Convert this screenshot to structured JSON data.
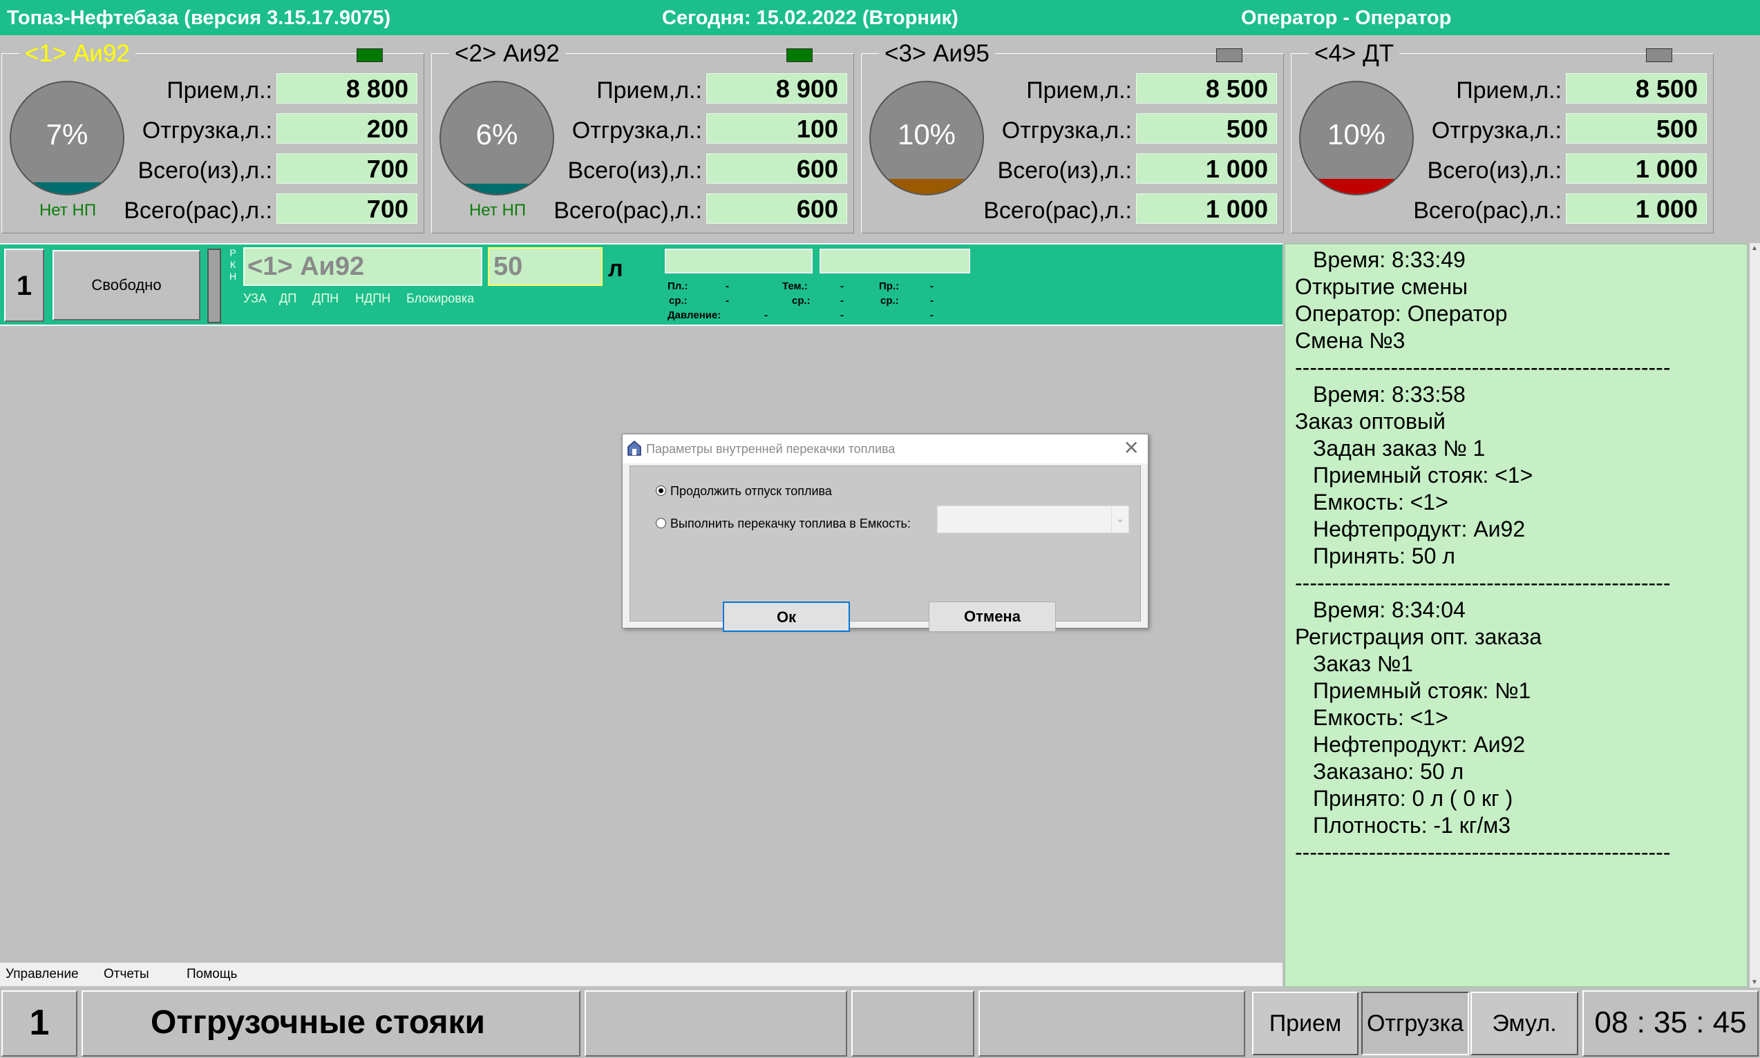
{
  "header": {
    "app_title": "Топаз-Нефтебаза  (версия 3.15.17.9075)",
    "date": "Сегодня: 15.02.2022  (Вторник)",
    "user": "Оператор - Оператор"
  },
  "labels": {
    "receive": "Прием,л.:",
    "ship": "Отгрузка,л.:",
    "total_in": "Всего(из),л.:",
    "total_out": "Всего(рас),л.:"
  },
  "tanks": [
    {
      "title": "<1> Аи92",
      "active": true,
      "led_color": "#007a00",
      "percent": "7%",
      "level": 0.07,
      "fill_color": "#006e6e",
      "status": "Нет НП",
      "receive": "8 800",
      "ship": "200",
      "total_in": "700",
      "total_out": "700"
    },
    {
      "title": "<2> Аи92",
      "active": false,
      "led_color": "#007a00",
      "percent": "6%",
      "level": 0.06,
      "fill_color": "#006e6e",
      "status": "Нет НП",
      "receive": "8 900",
      "ship": "100",
      "total_in": "600",
      "total_out": "600"
    },
    {
      "title": "<3> Аи95",
      "active": false,
      "led_color": "#8a8a8a",
      "percent": "10%",
      "level": 0.1,
      "fill_color": "#9a5a00",
      "status": "",
      "receive": "8 500",
      "ship": "500",
      "total_in": "1 000",
      "total_out": "1 000"
    },
    {
      "title": "<4> ДТ",
      "active": false,
      "led_color": "#8a8a8a",
      "percent": "10%",
      "level": 0.1,
      "fill_color": "#c00000",
      "status": "",
      "receive": "8 500",
      "ship": "500",
      "total_in": "1 000",
      "total_out": "1 000"
    }
  ],
  "post": {
    "number": "1",
    "state": "Свободно",
    "rkn": [
      "Р",
      "К",
      "Н"
    ],
    "product": "<1> Аи92",
    "dose": "50",
    "unit": "л",
    "flags": [
      "УЗА",
      "ДП",
      "ДПН",
      "НДПН",
      "Блокировка"
    ],
    "params": {
      "pl": "Пл.:",
      "tem": "Тем.:",
      "pr": "Пр.:",
      "sr": "ср.:",
      "pressure": "Давление:",
      "dash": "-"
    }
  },
  "log": [
    {
      "text": "Время: 8:33:49",
      "indent": true
    },
    {
      "text": "Открытие смены",
      "indent": false
    },
    {
      "text": "Оператор: Оператор",
      "indent": false
    },
    {
      "text": "Смена №3",
      "indent": false
    },
    {
      "text": "---------------------------------------------------",
      "indent": false
    },
    {
      "text": "Время: 8:33:58",
      "indent": true
    },
    {
      "text": "Заказ оптовый",
      "indent": false
    },
    {
      "text": "Задан заказ № 1",
      "indent": true
    },
    {
      "text": "Приемный стояк: <1>",
      "indent": true
    },
    {
      "text": "Емкость: <1>",
      "indent": true
    },
    {
      "text": "Нефтепродукт: Аи92",
      "indent": true
    },
    {
      "text": "Принять: 50 л",
      "indent": true
    },
    {
      "text": "---------------------------------------------------",
      "indent": false
    },
    {
      "text": "Время: 8:34:04",
      "indent": true
    },
    {
      "text": "Регистрация опт. заказа",
      "indent": false
    },
    {
      "text": "Заказ №1",
      "indent": true
    },
    {
      "text": "Приемный стояк: №1",
      "indent": true
    },
    {
      "text": "Емкость: <1>",
      "indent": true
    },
    {
      "text": "Нефтепродукт: Аи92",
      "indent": true
    },
    {
      "text": "Заказано: 50 л",
      "indent": true
    },
    {
      "text": "Принято: 0 л ( 0 кг )",
      "indent": true
    },
    {
      "text": "Плотность: -1 кг/м3",
      "indent": true
    },
    {
      "text": "---------------------------------------------------",
      "indent": false
    }
  ],
  "menu": [
    "Управление",
    "Отчеты",
    "Помощь"
  ],
  "bottom": {
    "number": "1",
    "section": "Отгрузочные стояки",
    "btn_receive": "Прием",
    "btn_ship": "Отгрузка",
    "btn_emul": "Эмул.",
    "clock": "08 : 35 : 45"
  },
  "dialog": {
    "title": "Параметры внутренней перекачки топлива",
    "option_continue": "Продолжить отпуск топлива",
    "option_transfer": "Выполнить перекачку топлива в Емкость:",
    "tank_select_value": "",
    "ok": "Ок",
    "cancel": "Отмена"
  }
}
